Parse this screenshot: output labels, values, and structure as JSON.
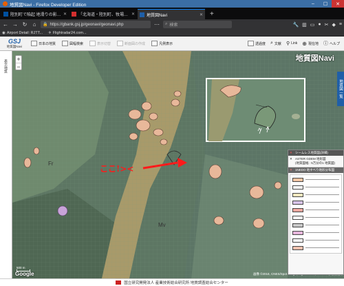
{
  "window": {
    "title": "地質図Navi - Firefox Developer Edition"
  },
  "tabs": [
    {
      "label": "陸別町で陥起 地滑りの影…"
    },
    {
      "label": "「北海道・陸別町、牧場…"
    },
    {
      "label": "地質図Navi",
      "active": true
    }
  ],
  "nav": {
    "url": "https://gbank.gsj.jp/geonavi/geonavi.php",
    "search_placeholder": "検索"
  },
  "bookmarks": [
    {
      "label": "Airport Detail: RJTT..."
    },
    {
      "label": "Flightradar24.com..."
    }
  ],
  "toolbar": {
    "logo_mark": "GSJ",
    "logo_name": "地質図Navi",
    "buttons": [
      {
        "label": "日本の地質",
        "enabled": true
      },
      {
        "label": "図幅検索",
        "enabled": true
      },
      {
        "label": "表示切替",
        "enabled": false
      },
      {
        "label": "断面図の作成",
        "enabled": false
      },
      {
        "label": "凡例表示",
        "enabled": true
      }
    ],
    "right_buttons": [
      {
        "label": "透過度"
      },
      {
        "label": "文献"
      },
      {
        "label": "Link"
      },
      {
        "label": "現在地"
      },
      {
        "label": "ヘルプ"
      }
    ]
  },
  "side_panel": {
    "label": "表示地質"
  },
  "map": {
    "overlay_title": "地質図Navi",
    "right_tab_label": "地質図一覧",
    "annotation_text": "ここ!><",
    "scale_label": "500 m",
    "attribution": "画像 ©2018, CNES/Spot Image, DigitalGlobe, Landsat | 利用規約",
    "google_label": "Google"
  },
  "legend": {
    "header": "シームレス地質図(詳細)",
    "item1": "ASTER GDEM 地形図",
    "item2": "(地質図幅 : 5万分の1 地質図)",
    "item3_header": "1NEDO 地すべり地形分布図",
    "swatch_colors": [
      "#f6c7a5",
      "#ffffff",
      "#f3e9c0",
      "#d7c3e8",
      "#f2a9a0",
      "#ffffff",
      "#c9c9c9",
      "#e8b7dd",
      "#ffffff",
      "#f4c3b0"
    ]
  },
  "footer": {
    "text": "国立研究開発法人 産業技術総合研究所 地質調査総合センター"
  }
}
